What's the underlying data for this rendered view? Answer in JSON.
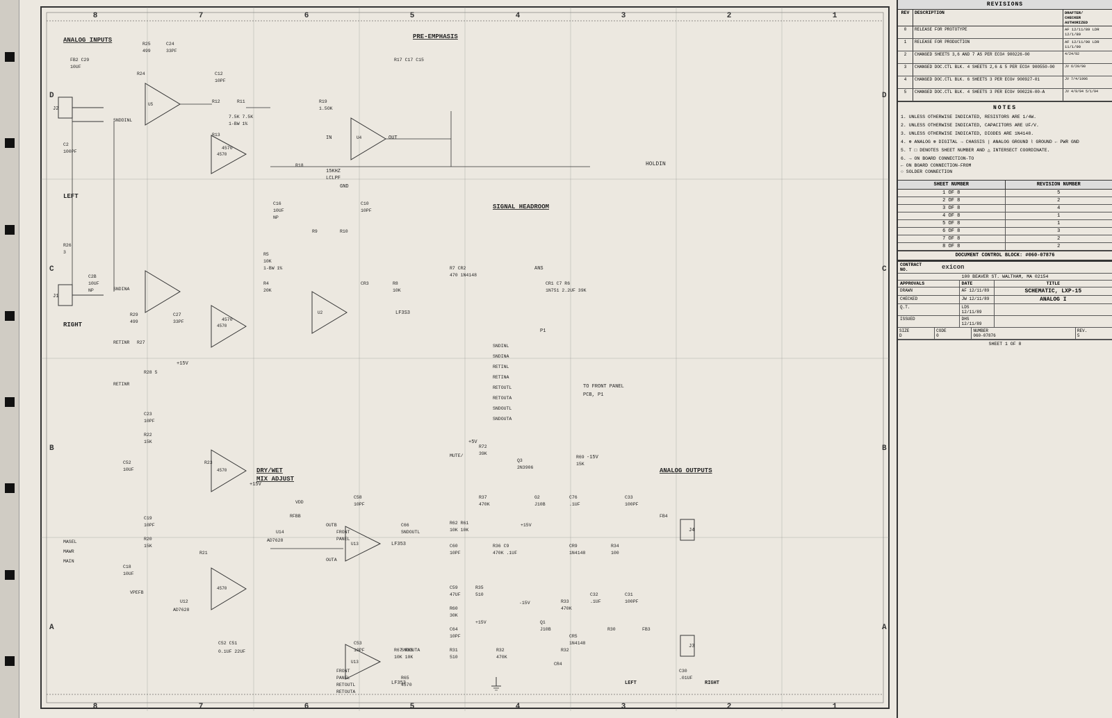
{
  "page": {
    "title": "SCHEMATIC, LXP-15 ANALOG I",
    "background_color": "#ece8e0"
  },
  "revisions": {
    "header": "REVISIONS",
    "columns": [
      "REV",
      "DESCRIPTION",
      "DRAFTER / CHECKER / AUTHORIZED"
    ],
    "rows": [
      {
        "rev": "0",
        "desc": "RELEASE FOR PROTOTYPE",
        "drafter": "AF 12/11/89 LDR 12/1/89"
      },
      {
        "rev": "1",
        "desc": "RELEASE FOR PRODUCTION",
        "drafter": "AF 12/11/90 LDR 11/1/90"
      },
      {
        "rev": "2",
        "desc": "CHANGED SHEETS 3,6 AND 7 AS PER ECO# 900226-00",
        "drafter": "4/24/92"
      },
      {
        "rev": "3",
        "desc": "CHANGED DOC.CTL BLK. 4 SHEETS 2,6 & 5 PER ECO# 900550-00",
        "drafter": "JV 6/20/90"
      },
      {
        "rev": "4",
        "desc": "CHANGED DOC.CTL BLK. 6 SHEETS 3 PER ECO# 900927-01",
        "drafter": "JV 7/4/1996"
      },
      {
        "rev": "5",
        "desc": "CHANGED DOC.CTL BLK. 4 SHEETS 3 PER ECO# 900226-00-A",
        "drafter": "JV 4/9/94 5/1/94"
      }
    ]
  },
  "notes": {
    "title": "NOTES",
    "items": [
      "1.  UNLESS OTHERWISE INDICATED, RESISTORS ARE 1/4W.",
      "2.  UNLESS OTHERWISE INDICATED, CAPACITORS ARE UF/V.",
      "3.  UNLESS OTHERWISE INDICATED, DIODES ARE 1N4148.",
      "4.  ⊕ ANALOG  ⊗ DIGITAL  → CHASSIS  | ANALOG GROUND  ⌇ GROUND  ← PWR GND",
      "5.  T □ DENOTES SHEET NUMBER AND △ INTERSECT COORDINATE.",
      "6.  → ON BOARD CONNECTION-TO\n    ← ON BOARD CONNECTION-FROM\n    ○ SOLDER CONNECTION"
    ]
  },
  "sheet_table": {
    "headers": [
      "SHEET NUMBER",
      "REVISION NUMBER"
    ],
    "rows": [
      {
        "sheet": "1 OF 8",
        "rev": "5"
      },
      {
        "sheet": "2 OF 8",
        "rev": "2"
      },
      {
        "sheet": "3 OF 8",
        "rev": "4"
      },
      {
        "sheet": "4 OF 8",
        "rev": "1"
      },
      {
        "sheet": "5 OF 8",
        "rev": "1"
      },
      {
        "sheet": "6 OF 8",
        "rev": "3"
      },
      {
        "sheet": "7 OF 8",
        "rev": "2"
      },
      {
        "sheet": "8 OF 8",
        "rev": "2"
      }
    ]
  },
  "doc_control": {
    "label": "DOCUMENT CONTROL BLOCK: #060-07876"
  },
  "title_block": {
    "contract_no": "",
    "company": "exicon",
    "address": "100 BEAVER ST. WALTHAM, MA 02154",
    "approvals_label": "APPROVALS",
    "date_label": "DATE",
    "title_label": "TITLE",
    "title": "SCHEMATIC, LXP-15",
    "subtitle": "ANALOG I",
    "drawn_label": "DRAWN",
    "drawn_by": "AF",
    "drawn_date": "12/11/89",
    "checked_label": "CHECKED",
    "checked_by": "JW",
    "checked_date": "12/11/89",
    "quality_label": "Q.T.",
    "quality_by": "LDS",
    "quality_date": "12/11/89",
    "issued_label": "ISSUED",
    "issued_by": "DHS",
    "issued_date": "12/11/89",
    "size_label": "SIZE",
    "size": "D",
    "code_label": "CODE",
    "code": "0",
    "number_label": "NUMBER",
    "number": "060-07876",
    "rev_label": "REV.",
    "rev": "5",
    "sheet_label": "SHEET 1 OF 8"
  },
  "grid": {
    "top_labels": [
      "8",
      "7",
      "6",
      "5",
      "4",
      "3",
      "2",
      "1"
    ],
    "left_labels": [
      "D",
      "C",
      "B",
      "A"
    ],
    "sections": {
      "analog_inputs": "ANALOG INPUTS",
      "pre_emphasis": "PRE-EMPHASIS",
      "signal_headroom": "SIGNAL HEADROOM",
      "dry_wet": "DRY/WET MIX ADJUST",
      "analog_outputs": "ANALOG OUTPUTS",
      "holdin": "HOLDIN",
      "left": "LEFT",
      "right": "RIGHT"
    }
  },
  "margin_squares": {
    "count": 8,
    "color": "#111111"
  }
}
